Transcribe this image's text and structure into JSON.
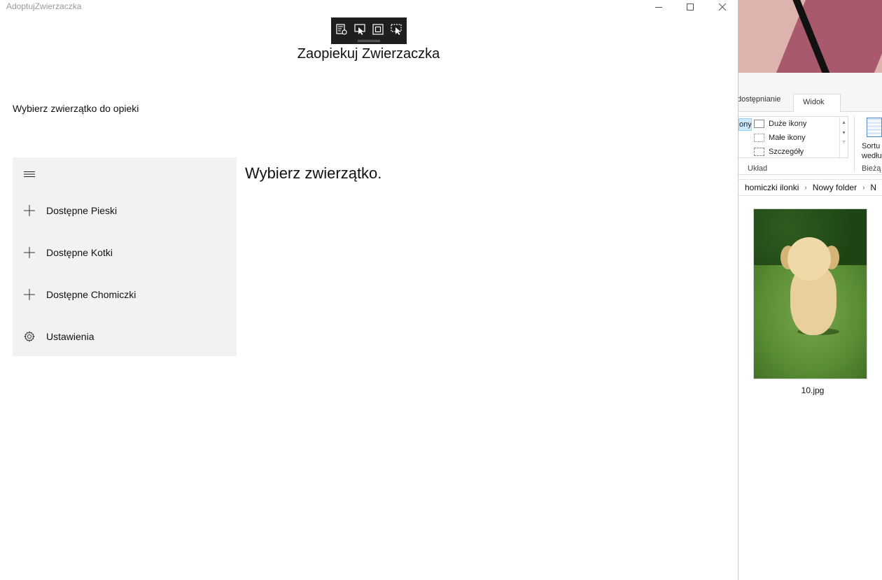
{
  "app": {
    "window_title": "AdoptujZwierzaczka",
    "page_title": "Zaopiekuj Zwierzaczka",
    "subtitle": "Wybierz zwierzątko do opieki",
    "content_heading": "Wybierz zwierzątko."
  },
  "nav": {
    "menu_icon": "hamburger-icon",
    "items": [
      {
        "label": "Dostępne Pieski",
        "icon": "plus-icon"
      },
      {
        "label": "Dostępne Kotki",
        "icon": "plus-icon"
      },
      {
        "label": "Dostępne Chomiczki",
        "icon": "plus-icon"
      },
      {
        "label": "Ustawienia",
        "icon": "gear-icon"
      }
    ]
  },
  "debug_toolbar": {
    "icons": [
      "visual-tree-icon",
      "select-element-icon",
      "layout-adorner-icon",
      "track-focus-icon"
    ]
  },
  "explorer": {
    "tabs": {
      "share": "dostępnianie",
      "view": "Widok"
    },
    "layout_selected": "ony",
    "layout_options": [
      "Duże ikony",
      "Małe ikony",
      "Szczegóły"
    ],
    "layout_group": "Układ",
    "sort_label": [
      "Sortu",
      "wedłu"
    ],
    "current_group": "Bieżą",
    "breadcrumb": [
      "homiczki ilonki",
      "Nowy folder",
      "N"
    ],
    "file_name": "10.jpg"
  }
}
